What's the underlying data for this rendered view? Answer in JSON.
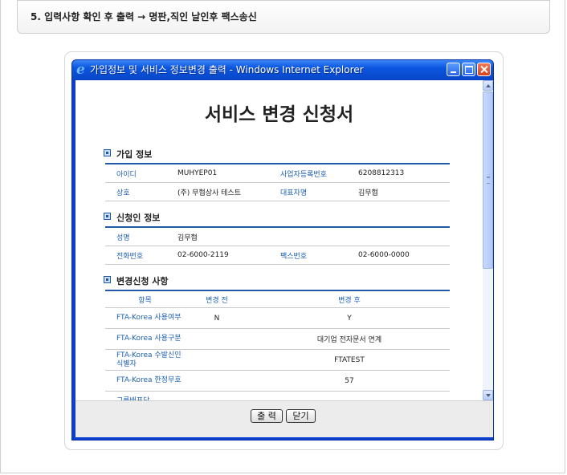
{
  "step_header": "5. 입력사항 확인 후 출력 → 명판,직인 날인후 팩스송신",
  "window": {
    "title": "가입정보 및 서비스 정보변경 출력 - Windows Internet Explorer",
    "logo_glyph": "e"
  },
  "form": {
    "title": "서비스 변경 신청서",
    "join_info": {
      "section_title": "가입 정보",
      "id_label": "아이디",
      "id_value": "MUHYEP01",
      "bizno_label": "사업자등록번호",
      "bizno_value": "6208812313",
      "company_label": "상호",
      "company_value": "(주) 무협상사 테스트",
      "ceo_label": "대표자명",
      "ceo_value": "김무협"
    },
    "applicant_info": {
      "section_title": "신청인 정보",
      "name_label": "성명",
      "name_value": "김무협",
      "phone_label": "전화번호",
      "phone_value": "02-6000-2119",
      "fax_label": "팩스번호",
      "fax_value": "02-6000-0000"
    },
    "change_request": {
      "section_title": "변경신청 사항",
      "col_item": "항목",
      "col_before": "변경 전",
      "col_after": "변경 후",
      "rows": [
        {
          "item": "FTA-Korea 사용여부",
          "before": "N",
          "after": "Y"
        },
        {
          "item": "FTA-Korea 사용구분",
          "before": "",
          "after": "대기업 전자문서 연계"
        },
        {
          "item": "FTA-Korea 수발신인식별자",
          "before": "",
          "after": "FTATEST"
        },
        {
          "item": "FTA-Korea 한정무호",
          "before": "",
          "after": "57"
        },
        {
          "item": "그룹배포담",
          "before": "",
          "after": ""
        }
      ]
    }
  },
  "buttons": {
    "print": "출 력",
    "close": "닫기"
  }
}
